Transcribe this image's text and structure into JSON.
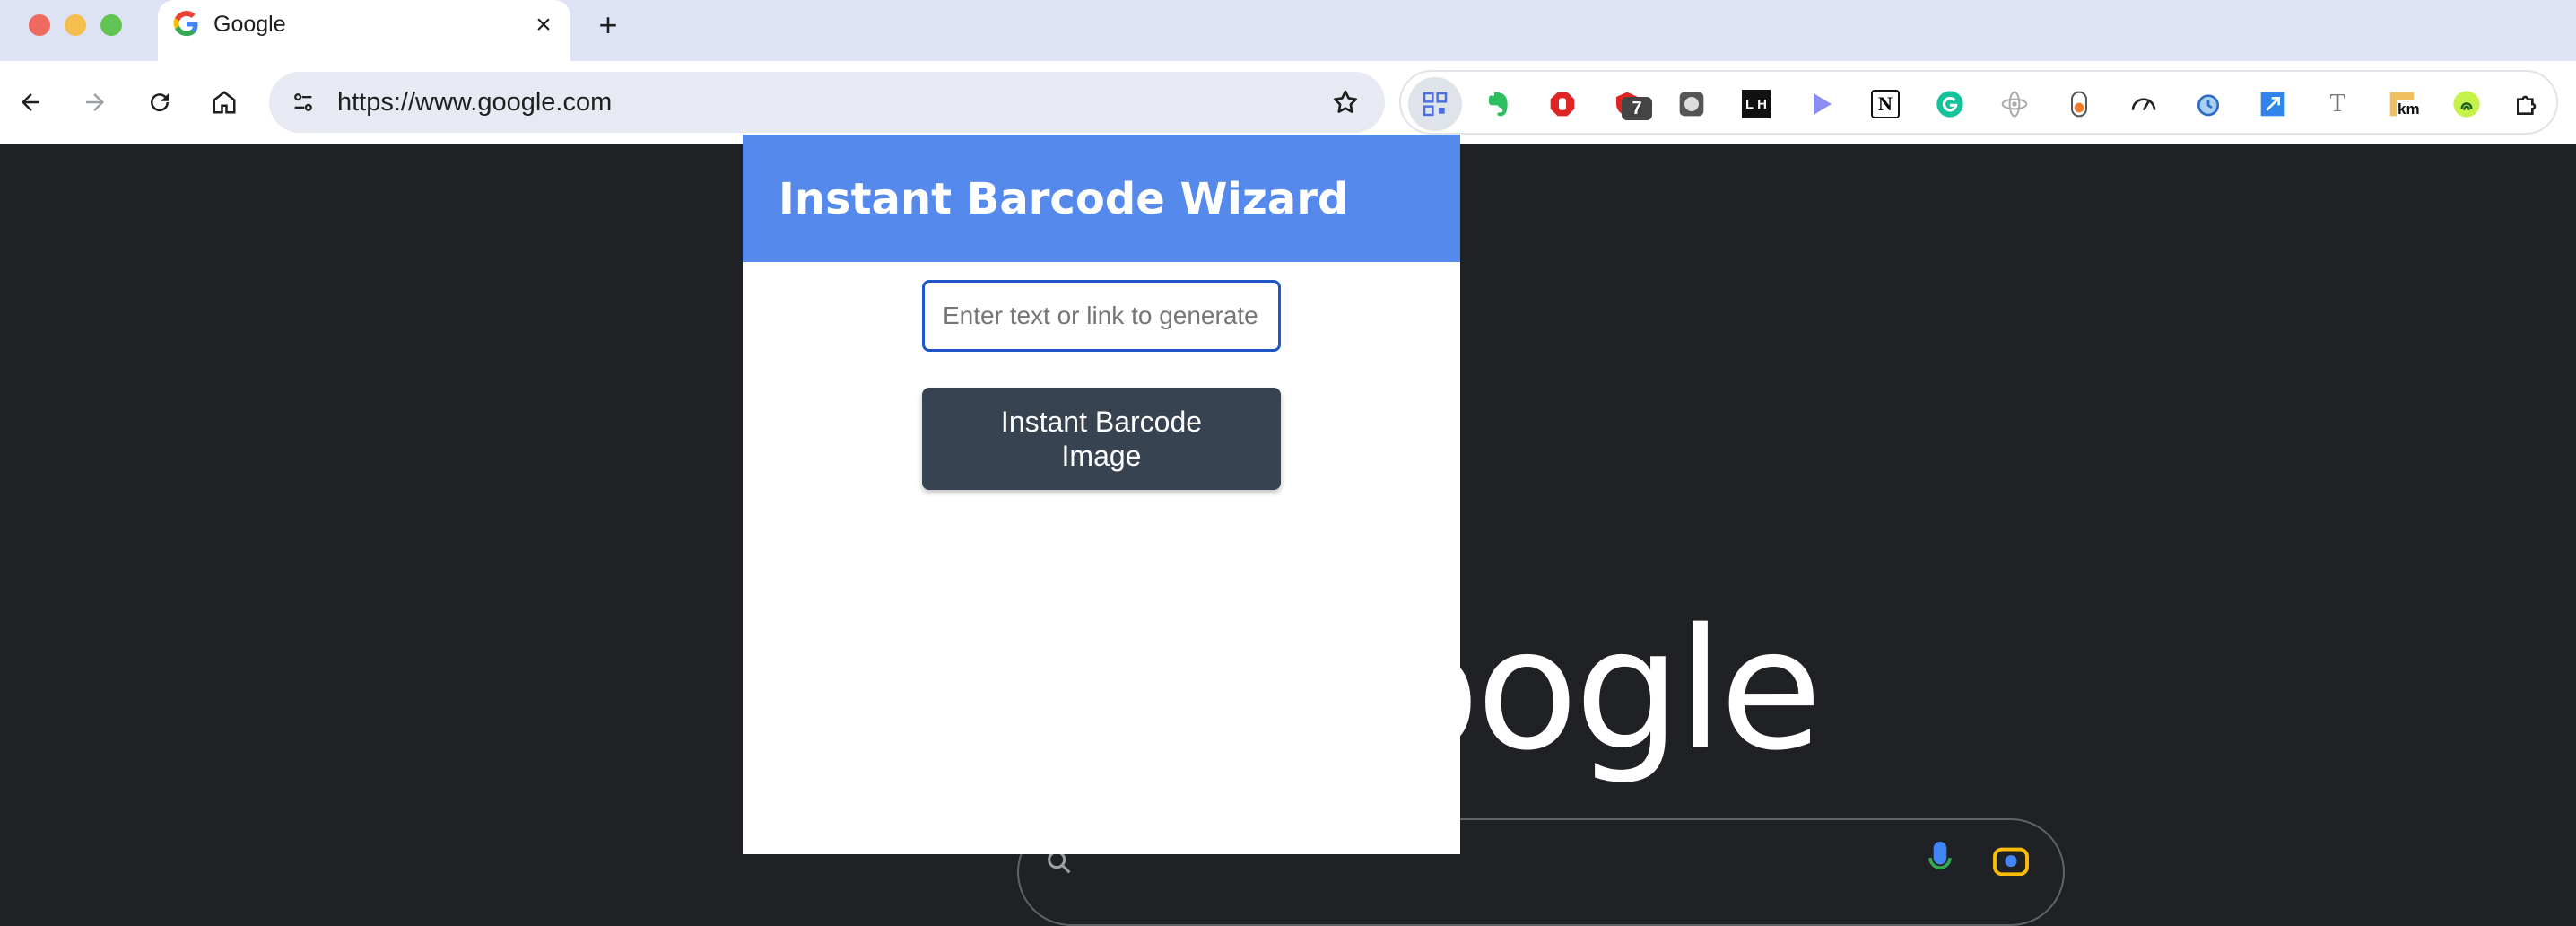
{
  "browser": {
    "tab_title": "Google",
    "tab_close": "×",
    "new_tab": "+",
    "url": "https://www.google.com",
    "extension_badge": "7",
    "ext_labels": {
      "lh": "L H",
      "notion": "N",
      "text": "T",
      "km": "km"
    }
  },
  "popup": {
    "title": "Instant Barcode Wizard",
    "input_placeholder": "Enter text or link to generate barcode",
    "button_label": "Instant Barcode Image"
  },
  "background_page": {
    "logo_fragment": "oogle"
  },
  "colors": {
    "popup_header": "#5589ec",
    "button": "#374351",
    "input_border": "#1e56c7",
    "page_background": "#202124"
  }
}
